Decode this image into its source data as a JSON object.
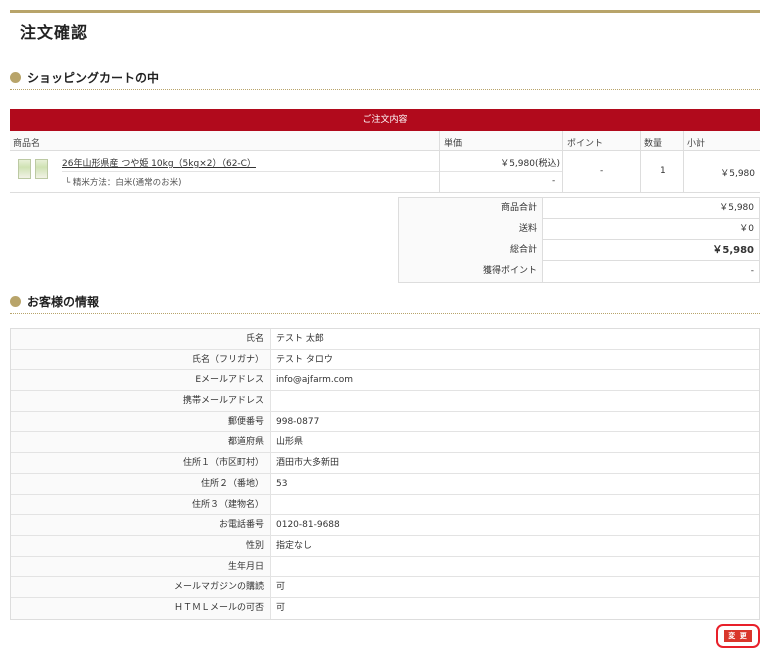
{
  "page_title": "注文確認",
  "cart_section": {
    "title": "ショッピングカートの中",
    "table_header": "ご注文内容",
    "columns": [
      "商品名",
      "単価",
      "ポイント",
      "数量",
      "小計"
    ],
    "item": {
      "name": "26年山形県産 つや姫 10kg（5kg×2）（62-C）",
      "option": "└ 精米方法：白米(通常のお米)",
      "unit_price": "￥5,980(税込)",
      "option_price": "-",
      "points": "-",
      "quantity": "1",
      "subtotal": "￥5,980"
    },
    "totals": [
      {
        "label": "商品合計",
        "value": "￥5,980"
      },
      {
        "label": "送料",
        "value": "￥0"
      },
      {
        "label": "総合計",
        "value": "￥5,980"
      },
      {
        "label": "獲得ポイント",
        "value": "-"
      }
    ]
  },
  "customer_section": {
    "title": "お客様の情報",
    "rows": [
      {
        "label": "氏名",
        "value": "テスト 太郎"
      },
      {
        "label": "氏名（フリガナ）",
        "value": "テスト タロウ"
      },
      {
        "label": "Eメールアドレス",
        "value": "info@ajfarm.com"
      },
      {
        "label": "携帯メールアドレス",
        "value": ""
      },
      {
        "label": "郵便番号",
        "value": "998-0877"
      },
      {
        "label": "都道府県",
        "value": "山形県"
      },
      {
        "label": "住所１（市区町村）",
        "value": "酒田市大多新田"
      },
      {
        "label": "住所２（番地）",
        "value": "53"
      },
      {
        "label": "住所３（建物名）",
        "value": ""
      },
      {
        "label": "お電話番号",
        "value": "0120-81-9688"
      },
      {
        "label": "性別",
        "value": "指定なし"
      },
      {
        "label": "生年月日",
        "value": ""
      },
      {
        "label": "メールマガジンの購読",
        "value": "可"
      },
      {
        "label": "ＨＴＭＬメールの可否",
        "value": "可"
      }
    ],
    "change_button": "変 更"
  },
  "colors": {
    "accent_gold": "#b8a46a",
    "header_red": "#b10a1c",
    "button_red": "#d9362b"
  },
  "icons": [
    "section-dot-icon",
    "product-thumbnail"
  ]
}
